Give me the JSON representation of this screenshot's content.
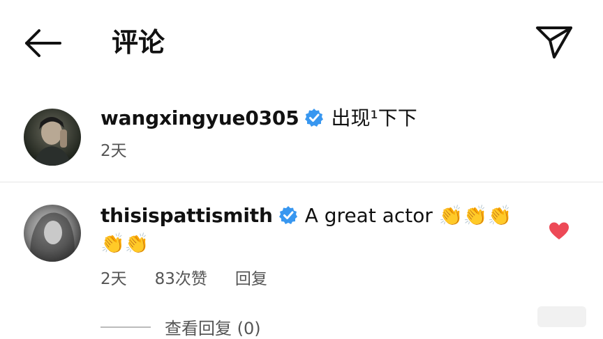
{
  "header": {
    "title": "评论",
    "back_icon": "arrow-left-icon",
    "share_icon": "send-paper-plane-icon"
  },
  "comments": [
    {
      "username": "wangxingyue0305",
      "verified": true,
      "text": "出现¹下下",
      "time": "2天",
      "avatar_icon": "profile-photo-dark"
    },
    {
      "username": "thisispattismith",
      "verified": true,
      "text": "A great actor",
      "emojis_line1": "👏👏👏",
      "emojis_line2": "👏👏",
      "time": "2天",
      "likes": "83次赞",
      "reply_label": "回复",
      "liked": true,
      "avatar_icon": "profile-photo-grayscale"
    }
  ],
  "view_replies": {
    "label": "查看回复 (0)"
  },
  "colors": {
    "verified_blue": "#3897f0",
    "heart_red": "#ed4956",
    "text_primary": "#111111",
    "text_secondary": "#555555",
    "divider": "#e6e6e6"
  }
}
